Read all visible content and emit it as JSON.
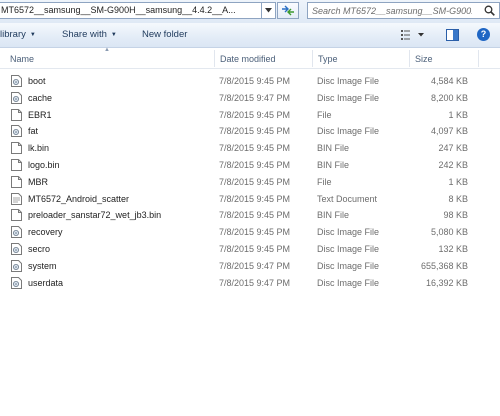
{
  "address": {
    "path": "MT6572__samsung__SM-G900H__samsung__4.4.2__A..."
  },
  "search": {
    "placeholder": "Search MT6572__samsung__SM-G900..."
  },
  "toolbar": {
    "library_label": "library",
    "share_label": "Share with",
    "new_folder_label": "New folder",
    "help_label": "?"
  },
  "columns": {
    "name": "Name",
    "date": "Date modified",
    "type": "Type",
    "size": "Size"
  },
  "files": [
    {
      "icon": "disc-image-icon",
      "name": "boot",
      "date": "7/8/2015 9:45 PM",
      "type": "Disc Image File",
      "size": "4,584 KB"
    },
    {
      "icon": "disc-image-icon",
      "name": "cache",
      "date": "7/8/2015 9:47 PM",
      "type": "Disc Image File",
      "size": "8,200 KB"
    },
    {
      "icon": "file-icon",
      "name": "EBR1",
      "date": "7/8/2015 9:45 PM",
      "type": "File",
      "size": "1 KB"
    },
    {
      "icon": "disc-image-icon",
      "name": "fat",
      "date": "7/8/2015 9:45 PM",
      "type": "Disc Image File",
      "size": "4,097 KB"
    },
    {
      "icon": "file-icon",
      "name": "lk.bin",
      "date": "7/8/2015 9:45 PM",
      "type": "BIN File",
      "size": "247 KB"
    },
    {
      "icon": "file-icon",
      "name": "logo.bin",
      "date": "7/8/2015 9:45 PM",
      "type": "BIN File",
      "size": "242 KB"
    },
    {
      "icon": "file-icon",
      "name": "MBR",
      "date": "7/8/2015 9:45 PM",
      "type": "File",
      "size": "1 KB"
    },
    {
      "icon": "text-document-icon",
      "name": "MT6572_Android_scatter",
      "date": "7/8/2015 9:45 PM",
      "type": "Text Document",
      "size": "8 KB"
    },
    {
      "icon": "file-icon",
      "name": "preloader_sanstar72_wet_jb3.bin",
      "date": "7/8/2015 9:45 PM",
      "type": "BIN File",
      "size": "98 KB"
    },
    {
      "icon": "disc-image-icon",
      "name": "recovery",
      "date": "7/8/2015 9:45 PM",
      "type": "Disc Image File",
      "size": "5,080 KB"
    },
    {
      "icon": "disc-image-icon",
      "name": "secro",
      "date": "7/8/2015 9:45 PM",
      "type": "Disc Image File",
      "size": "132 KB"
    },
    {
      "icon": "disc-image-icon",
      "name": "system",
      "date": "7/8/2015 9:47 PM",
      "type": "Disc Image File",
      "size": "655,368 KB"
    },
    {
      "icon": "disc-image-icon",
      "name": "userdata",
      "date": "7/8/2015 9:47 PM",
      "type": "Disc Image File",
      "size": "16,392 KB"
    }
  ]
}
